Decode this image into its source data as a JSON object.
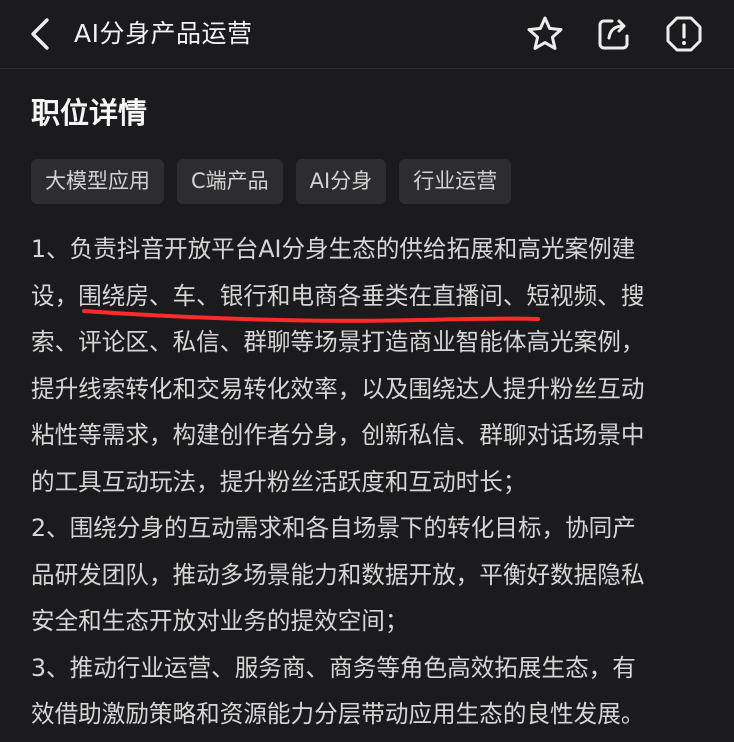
{
  "header": {
    "title": "AI分身产品运营"
  },
  "section": {
    "title": "职位详情"
  },
  "tags": [
    "大模型应用",
    "C端产品",
    "AI分身",
    "行业运营"
  ],
  "description_lines": [
    "1、负责抖音开放平台AI分身生态的供给拓展和高光案例建",
    "设，围绕房、车、银行和电商各垂类在直播间、短视频、搜",
    "索、评论区、私信、群聊等场景打造商业智能体高光案例，",
    "提升线索转化和交易转化效率，以及围绕达人提升粉丝互动",
    "粘性等需求，构建创作者分身，创新私信、群聊对话场景中",
    "的工具互动玩法，提升粉丝活跃度和互动时长；",
    "2、围绕分身的互动需求和各自场景下的转化目标，协同产",
    "品研发团队，推动多场景能力和数据开放，平衡好数据隐私",
    "安全和生态开放对业务的提效空间；",
    "3、推动行业运营、服务商、商务等角色高效拓展生态，有",
    "效借助激励策略和资源能力分层带动应用生态的良性发展。"
  ],
  "colors": {
    "background": "#1b1b1d",
    "tag_background": "#2d2d30",
    "annotation_underline": "#ff2b2b"
  },
  "icons": {
    "back": "chevron-left-icon",
    "favorite": "star-icon",
    "share": "share-icon",
    "report": "alert-icon"
  }
}
